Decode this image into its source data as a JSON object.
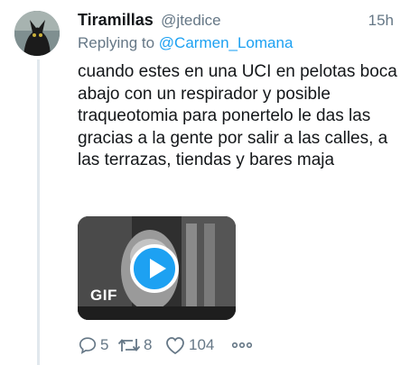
{
  "tweet": {
    "display_name": "Tiramillas",
    "handle": "@jtedice",
    "time": "15h",
    "replying_prefix": "Replying to",
    "replying_to": "@Carmen_Lomana",
    "text": "cuando estes en una UCI en pelotas boca abajo con un respirador y posible traqueotomia para ponertelo le das las gracias a la gente por salir a las calles, a las terrazas, tiendas y bares maja"
  },
  "media": {
    "badge": "GIF",
    "play_icon": "play-icon"
  },
  "actions": {
    "replies": "5",
    "retweets": "8",
    "likes": "104",
    "reply_icon": "reply-icon",
    "retweet_icon": "retweet-icon",
    "like_icon": "heart-icon",
    "more_icon": "more-icon"
  },
  "colors": {
    "accent": "#1da1f2",
    "muted": "#657786",
    "text": "#14171a",
    "thread_line": "#e1e8ed"
  }
}
